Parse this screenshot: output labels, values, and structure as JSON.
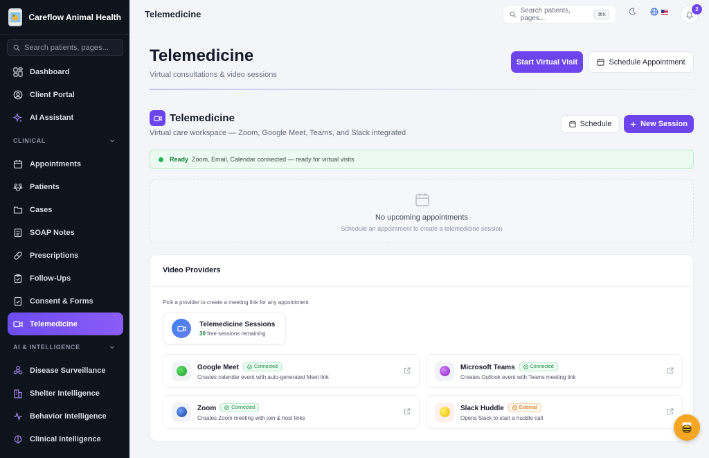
{
  "sidebar": {
    "brand_name": "Careflow Animal Health",
    "search_placeholder": "Search patients, pages...",
    "items_top": [
      {
        "label": "Dashboard",
        "icon": "dashboard-icon"
      },
      {
        "label": "Client Portal",
        "icon": "user-circle-icon"
      },
      {
        "label": "AI Assistant",
        "icon": "sparkles-icon"
      }
    ],
    "section_clinical": "CLINICAL",
    "items_clinical": [
      {
        "label": "Appointments",
        "icon": "calendar-icon"
      },
      {
        "label": "Patients",
        "icon": "paw-icon"
      },
      {
        "label": "Cases",
        "icon": "folder-icon"
      },
      {
        "label": "SOAP Notes",
        "icon": "document-icon"
      },
      {
        "label": "Prescriptions",
        "icon": "pill-icon"
      },
      {
        "label": "Follow-Ups",
        "icon": "clipboard-icon"
      },
      {
        "label": "Consent & Forms",
        "icon": "form-icon"
      },
      {
        "label": "Telemedicine",
        "icon": "video-icon",
        "active": true
      }
    ],
    "section_ai": "AI & INTELLIGENCE",
    "items_ai": [
      {
        "label": "Disease Surveillance",
        "icon": "biohazard-icon"
      },
      {
        "label": "Shelter Intelligence",
        "icon": "building-icon"
      },
      {
        "label": "Behavior Intelligence",
        "icon": "activity-icon"
      },
      {
        "label": "Clinical Intelligence",
        "icon": "brain-icon"
      }
    ]
  },
  "topbar": {
    "title": "Telemedicine",
    "search_placeholder": "Search patients, pages...",
    "shortcut": "⌘K",
    "notification_count": "2"
  },
  "header": {
    "title": "Telemedicine",
    "subtitle": "Virtual consultations & video sessions",
    "start_visit_label": "Start Virtual Visit",
    "schedule_appointment_label": "Schedule Appointment"
  },
  "workspace": {
    "title": "Telemedicine",
    "subtitle": "Virtual care workspace — Zoom, Google Meet, Teams, and Slack integrated",
    "schedule_label": "Schedule",
    "new_session_label": "New Session",
    "ready_label": "Ready",
    "ready_text": "Zoom, Email, Calendar connected — ready for virtual visits",
    "empty_title": "No upcoming appointments",
    "empty_sub": "Schedule an appointment to create a telemedicine session"
  },
  "providers": {
    "title": "Video Providers",
    "hint": "Pick a provider to create a meeting link for any appointment",
    "sessions_title": "Telemedicine Sessions",
    "sessions_count": "30",
    "sessions_suffix": "free sessions remaining",
    "list": [
      {
        "name": "Google Meet",
        "status": "Connected",
        "desc": "Creates calendar event with auto-generated Meet link",
        "color": "#22a82e"
      },
      {
        "name": "Microsoft Teams",
        "status": "Connected",
        "desc": "Creates Outlook event with Teams meeting link",
        "color": "#9b30d9"
      },
      {
        "name": "Zoom",
        "status": "Connected",
        "desc": "Creates Zoom meeting with join & host links",
        "color": "#1f57c8"
      },
      {
        "name": "Slack Huddle",
        "status": "External",
        "desc": "Opens Slack to start a huddle call",
        "color": "#f2d00f"
      }
    ]
  },
  "colors": {
    "accent": "#6d45ee",
    "sidebar_bg": "#0e141c",
    "success": "#22b35a"
  }
}
